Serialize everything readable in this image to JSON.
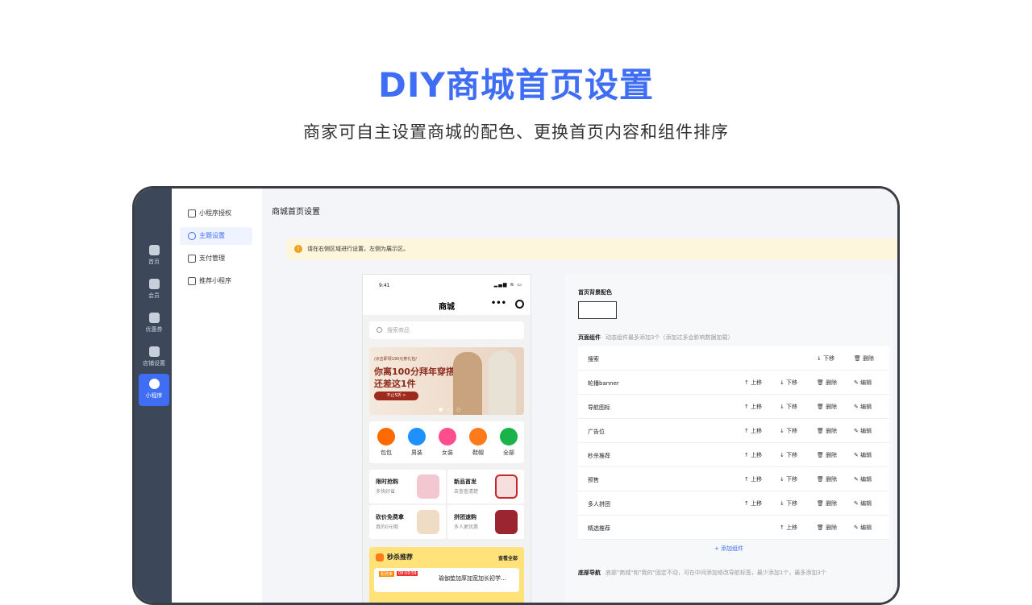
{
  "hero": {
    "title": "DIY商城首页设置",
    "subtitle": "商家可自主设置商城的配色、更换首页内容和组件排序"
  },
  "dark_nav": [
    {
      "label": "首页",
      "icon": "home-icon"
    },
    {
      "label": "会员",
      "icon": "member-icon"
    },
    {
      "label": "优惠券",
      "icon": "coupon-icon"
    },
    {
      "label": "店铺设置",
      "icon": "store-icon"
    },
    {
      "label": "小程序",
      "icon": "mini-program-icon",
      "active": true
    }
  ],
  "sub_nav": [
    {
      "label": "小程序授权",
      "icon": "authorize-icon"
    },
    {
      "label": "主题设置",
      "icon": "theme-icon",
      "active": true
    },
    {
      "label": "支付管理",
      "icon": "wallet-icon"
    },
    {
      "label": "推荐小程序",
      "icon": "thumbs-up-icon"
    }
  ],
  "page": {
    "title": "商城首页设置",
    "notice": "请在右侧区域进行设置，左侧为展示区。"
  },
  "phone": {
    "time": "9:41",
    "signal": "▂▄▆ ≋ ▭",
    "title": "商城",
    "more": "•••",
    "search_placeholder": "搜索商品",
    "banner": {
      "tag": "/点击即领190元券礼包/",
      "line1": "你离100分拜年穿搭",
      "line2": "还差这1件",
      "button": "不止5折 >",
      "dots": "● ○ ○"
    },
    "categories": [
      {
        "label": "包包",
        "color": "#ff6a00"
      },
      {
        "label": "男装",
        "color": "#1e90ff"
      },
      {
        "label": "女装",
        "color": "#ff4d8d"
      },
      {
        "label": "鞋帽",
        "color": "#ff7a1a"
      },
      {
        "label": "全部",
        "color": "#19b34a"
      }
    ],
    "cells": [
      {
        "title": "限时抢购",
        "sub": "多快好省"
      },
      {
        "title": "新品首发",
        "sub": "去查查清楚"
      },
      {
        "title": "砍价免费拿",
        "sub": "真的0元哦"
      },
      {
        "title": "拼团速购",
        "sub": "多人更优惠"
      }
    ],
    "flash": {
      "title": "秒杀推荐",
      "more": "查看全部",
      "badge": "距结束",
      "timer": "09:59:59",
      "product": "瑜伽垫加厚加宽加长初学..."
    }
  },
  "settings": {
    "bg_color_label": "首页背景配色",
    "bg_color": "#ffffff",
    "components_label": "页面组件",
    "components_hint": "动态组件最多添加3个（添加过多会影响数据加载）",
    "actions": {
      "up": "上移",
      "down": "下移",
      "delete": "删除",
      "edit": "编辑"
    },
    "components": [
      {
        "name": "搜索"
      },
      {
        "name": "轮播banner"
      },
      {
        "name": "导航图标"
      },
      {
        "name": "广告位"
      },
      {
        "name": "秒杀推荐"
      },
      {
        "name": "预售"
      },
      {
        "name": "多人拼团"
      },
      {
        "name": "精选推荐"
      }
    ],
    "add_component": "+ 添加组件",
    "bottom_nav_label": "底部导航",
    "bottom_nav_hint": "底部\"商城\"和\"我的\"固定不动，可在中间添加修改导航标签，最少添加1个，最多添加3个"
  }
}
